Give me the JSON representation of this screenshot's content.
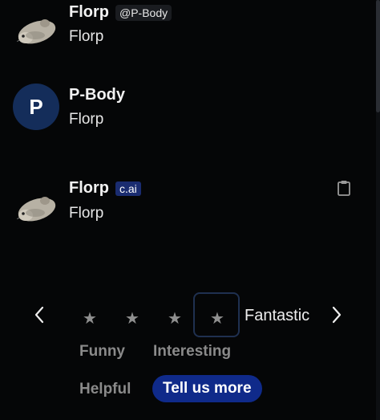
{
  "messages": [
    {
      "author": "Florp",
      "handle": "@P-Body",
      "text": "Florp",
      "avatar": "rat-avatar"
    },
    {
      "author": "P-Body",
      "avatar_letter": "P",
      "text": "Florp"
    },
    {
      "author": "Florp",
      "badge": "c.ai",
      "text": "Florp",
      "avatar": "rat-avatar"
    }
  ],
  "rating": {
    "star_glyph": "★",
    "selected_stars": 4,
    "max_stars": 4,
    "label": "Fantastic",
    "tags": [
      "Funny",
      "Interesting",
      "Helpful"
    ],
    "tell_more": "Tell us more"
  },
  "colors": {
    "background": "#050607",
    "badge_cai": "#1a2c70",
    "avatar_p": "#142d5a",
    "tell_more_button": "#0f2a8a",
    "tag_text": "#8a8a8a"
  },
  "icons": {
    "copy": "clipboard-icon",
    "prev": "chevron-left-icon",
    "next": "chevron-right-icon"
  }
}
